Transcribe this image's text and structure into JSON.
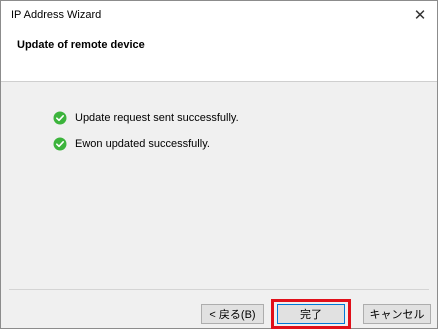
{
  "window": {
    "title": "IP Address Wizard"
  },
  "header": {
    "title": "Update of remote device"
  },
  "messages": [
    {
      "icon": "check-circle-icon",
      "text": "Update request sent successfully."
    },
    {
      "icon": "check-circle-icon",
      "text": "Ewon updated successfully."
    }
  ],
  "buttons": {
    "back_label": "< 戻る(B)",
    "finish_label": "完了",
    "cancel_label": "キャンセル"
  },
  "colors": {
    "highlight": "#e0101a",
    "success": "#3cb43c"
  }
}
